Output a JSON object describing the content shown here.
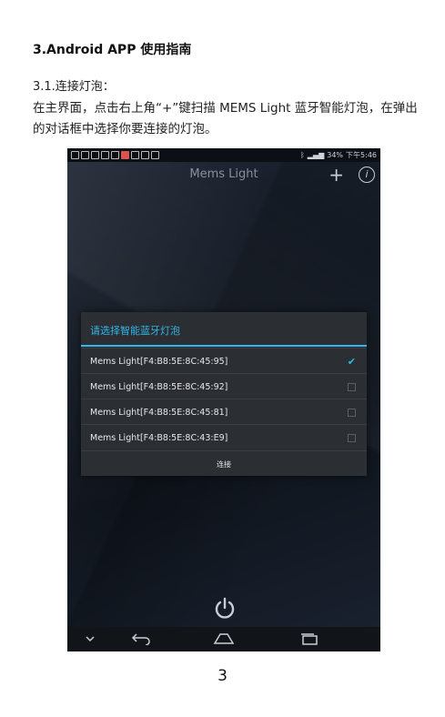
{
  "doc": {
    "heading": "3.Android APP 使用指南",
    "subheading": "3.1.连接灯泡：",
    "paragraph": "在主界面，点击右上角“+”键扫描 MEMS Light 蓝牙智能灯泡，在弹出的对话框中选择你要连接的灯泡。",
    "page_number": "3"
  },
  "phone": {
    "status": {
      "battery": "34%",
      "time": "下午5:46"
    },
    "app_title": "Mems Light",
    "plus_icon": "plus-icon",
    "info_icon": "info-icon",
    "dialog": {
      "title": "请选择智能蓝牙灯泡",
      "devices": [
        {
          "name": "Mems Light[F4:B8:5E:8C:45:95]",
          "checked": true
        },
        {
          "name": "Mems Light[F4:B8:5E:8C:45:92]",
          "checked": false
        },
        {
          "name": "Mems Light[F4:B8:5E:8C:45:81]",
          "checked": false
        },
        {
          "name": "Mems Light[F4:B8:5E:8C:43:E9]",
          "checked": false
        }
      ],
      "connect_label": "连接"
    },
    "power_icon": "power-icon",
    "accent": "#33b5e5"
  }
}
